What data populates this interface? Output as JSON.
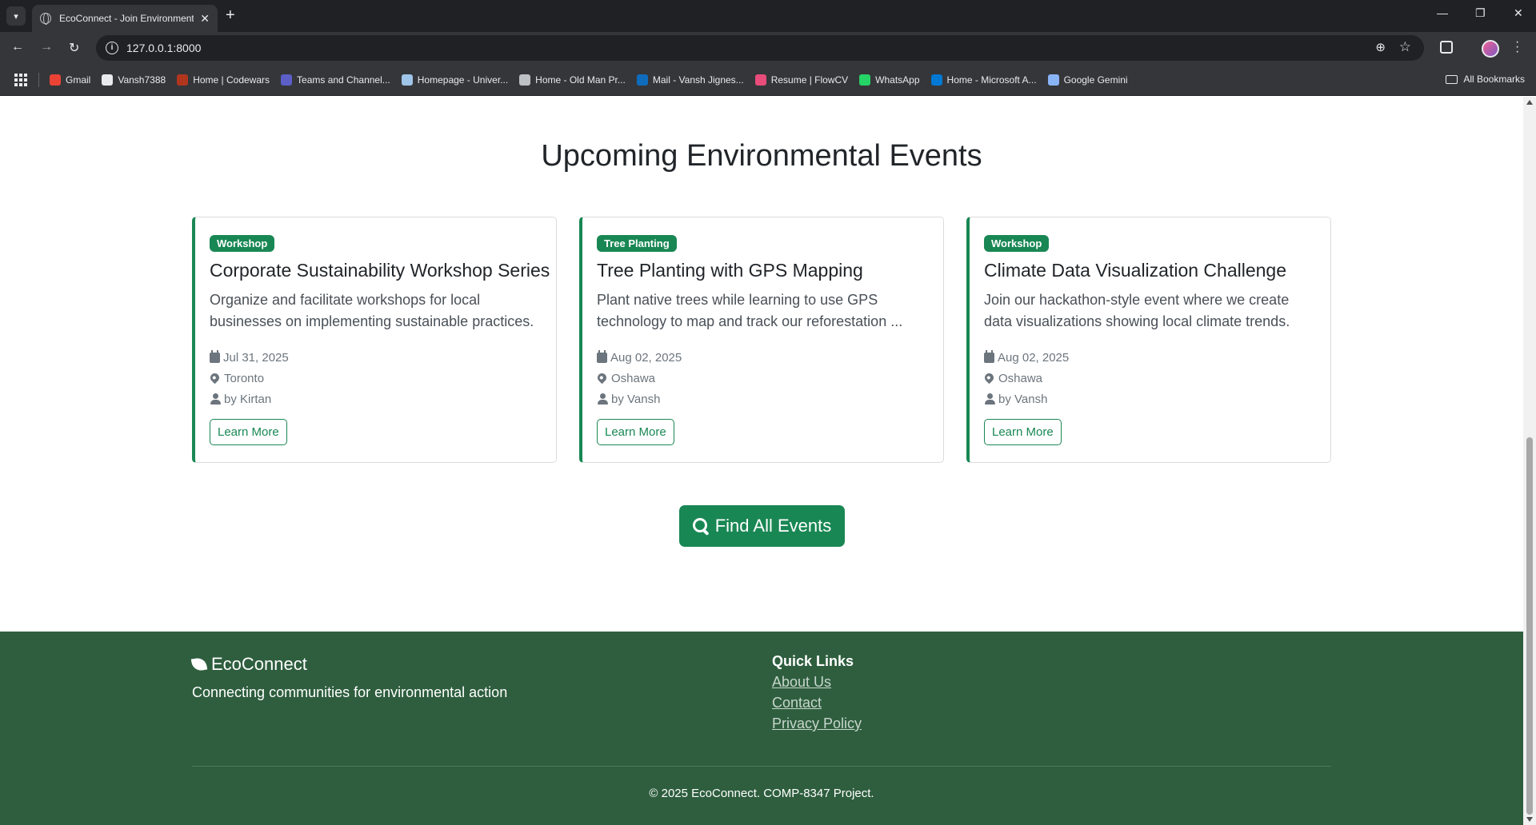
{
  "browser": {
    "tab_title": "EcoConnect - Join Environment",
    "url": "127.0.0.1:8000",
    "bookmarks": [
      {
        "label": "Gmail",
        "color": "#ea4335"
      },
      {
        "label": "Vansh7388",
        "color": "#e8eaed"
      },
      {
        "label": "Home | Codewars",
        "color": "#b1361e"
      },
      {
        "label": "Teams and Channel...",
        "color": "#5b5fc7"
      },
      {
        "label": "Homepage - Univer...",
        "color": "#9fc5e8"
      },
      {
        "label": "Home - Old Man Pr...",
        "color": "#bdc1c6"
      },
      {
        "label": "Mail - Vansh Jignes...",
        "color": "#0f6cbd"
      },
      {
        "label": "Resume | FlowCV",
        "color": "#e84c7b"
      },
      {
        "label": "WhatsApp",
        "color": "#25d366"
      },
      {
        "label": "Home - Microsoft A...",
        "color": "#0078d4"
      },
      {
        "label": "Google Gemini",
        "color": "#8ab4f8"
      }
    ],
    "all_bookmarks": "All Bookmarks"
  },
  "main": {
    "section_title": "Upcoming Environmental Events",
    "events": [
      {
        "category": "Workshop",
        "title": "Corporate Sustainability Workshop Series",
        "description": "Organize and facilitate workshops for local businesses on implementing sustainable practices.",
        "date": "Jul 31, 2025",
        "location": "Toronto",
        "organizer": "by Kirtan",
        "button": "Learn More"
      },
      {
        "category": "Tree Planting",
        "title": "Tree Planting with GPS Mapping",
        "description": "Plant native trees while learning to use GPS technology to map and track our reforestation ...",
        "date": "Aug 02, 2025",
        "location": "Oshawa",
        "organizer": "by Vansh",
        "button": "Learn More"
      },
      {
        "category": "Workshop",
        "title": "Climate Data Visualization Challenge",
        "description": "Join our hackathon-style event where we create data visualizations showing local climate trends.",
        "date": "Aug 02, 2025",
        "location": "Oshawa",
        "organizer": "by Vansh",
        "button": "Learn More"
      }
    ],
    "find_button": "Find All Events"
  },
  "footer": {
    "brand": "EcoConnect",
    "tagline": "Connecting communities for environmental action",
    "quick_links_title": "Quick Links",
    "links": [
      "About Us",
      "Contact",
      "Privacy Policy"
    ],
    "copyright": "© 2025 EcoConnect. COMP-8347 Project."
  },
  "colors": {
    "primary": "#198754",
    "footer_bg": "#2e5e3e"
  }
}
